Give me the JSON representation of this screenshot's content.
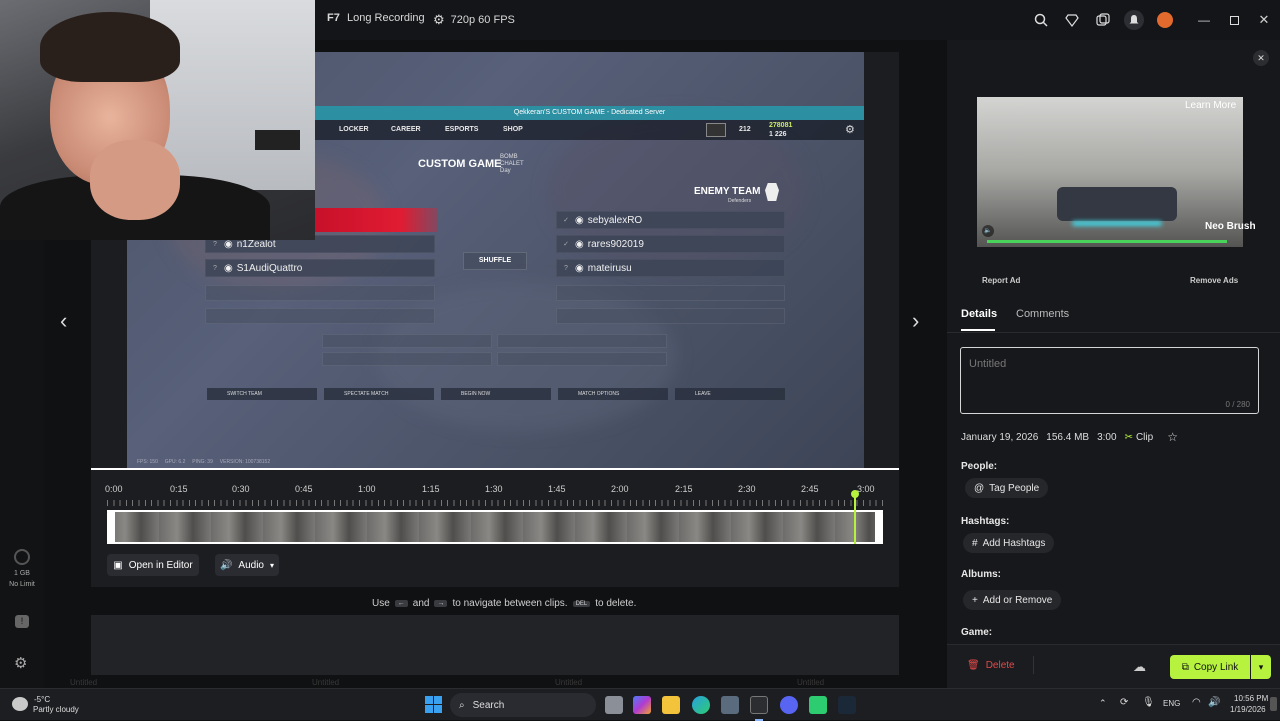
{
  "topbar": {
    "hotkey": "F7",
    "mode": "Long Recording",
    "quality": "720p 60 FPS"
  },
  "sidebar": {
    "storage": "1 GB",
    "storage_limit": "No Limit"
  },
  "game": {
    "server_banner": "Qekkeran'S CUSTOM GAME - Dedicated Server",
    "nav": [
      "LOCKER",
      "CAREER",
      "ESPORTS",
      "SHOP"
    ],
    "mode_title": "CUSTOM GAME",
    "mode_sub": [
      "BOMB",
      "CHALET",
      "Day"
    ],
    "enemy_title": "ENEMY TEAM",
    "enemy_sub": "Defenders",
    "ally_players": [
      "n1Zealot",
      "S1AudiQuattro"
    ],
    "enemy_players": [
      "sebyalexRO",
      "rares902019",
      "mateirusu"
    ],
    "shuffle": "SHUFFLE",
    "actions": [
      "SWITCH TEAM",
      "SPECTATE MATCH",
      "BEGIN NOW",
      "MATCH OPTIONS",
      "LEAVE"
    ],
    "stats": "FPS: 150     GPU: 6.2     PING: 39     VERSION: 100738152",
    "currency_top": "278081",
    "currency_bottom": "1 226",
    "level": "212"
  },
  "timeline": {
    "ticks": [
      "0:00",
      "0:15",
      "0:30",
      "0:45",
      "1:00",
      "1:15",
      "1:30",
      "1:45",
      "2:00",
      "2:15",
      "2:30",
      "2:45",
      "3:00"
    ],
    "playhead": 0.963
  },
  "actions": {
    "open_editor": "Open in Editor",
    "audio": "Audio",
    "hint_pre": "Use",
    "hint_and": "and",
    "hint_mid": "to navigate between clips.",
    "hint_del_key": "DEL",
    "hint_post": "to delete."
  },
  "ad": {
    "learn_more": "Learn More",
    "brand": "Neo Brush",
    "report": "Report Ad",
    "remove": "Remove Ads"
  },
  "details": {
    "tabs": [
      "Details",
      "Comments"
    ],
    "title_placeholder": "Untitled",
    "char_count": "0 / 280",
    "date": "January 19, 2026",
    "size": "156.4 MB",
    "duration": "3:00",
    "type": "Clip",
    "people_label": "People:",
    "tag_people": "Tag People",
    "hashtags_label": "Hashtags:",
    "add_hashtags": "Add Hashtags",
    "albums_label": "Albums:",
    "add_remove": "Add or Remove",
    "game_label": "Game:",
    "delete": "Delete",
    "copy_link": "Copy Link",
    "accent": "#b6f23e",
    "delete_color": "#e04a4a"
  },
  "taskbar": {
    "weather_temp": "-5°C",
    "weather_desc": "Partly cloudy",
    "search": "Search",
    "lang": "ENG",
    "time": "10:56 PM",
    "date": "1/19/2026"
  },
  "gallery_labels": [
    "Untitled",
    "Untitled",
    "Untitled",
    "Untitled"
  ]
}
